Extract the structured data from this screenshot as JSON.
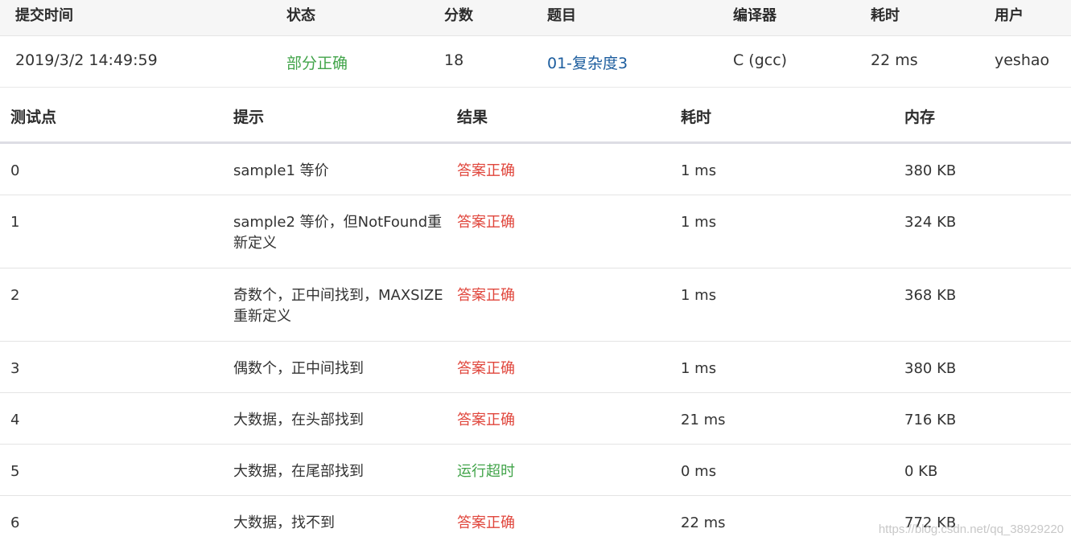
{
  "submission": {
    "headers": [
      "提交时间",
      "状态",
      "分数",
      "题目",
      "编译器",
      "耗时",
      "用户"
    ],
    "row": {
      "time": "2019/3/2 14:49:59",
      "status": "部分正确",
      "score": "18",
      "problem": "01-复杂度3",
      "compiler": "C (gcc)",
      "duration": "22 ms",
      "user": "yeshao"
    }
  },
  "testcases": {
    "headers": [
      "测试点",
      "提示",
      "结果",
      "耗时",
      "内存"
    ],
    "rows": [
      {
        "id": "0",
        "hint": "sample1 等价",
        "result": "答案正确",
        "time": "1 ms",
        "memory": "380 KB"
      },
      {
        "id": "1",
        "hint": "sample2 等价，但NotFound重新定义",
        "result": "答案正确",
        "time": "1 ms",
        "memory": "324 KB"
      },
      {
        "id": "2",
        "hint": "奇数个，正中间找到，MAXSIZE重新定义",
        "result": "答案正确",
        "time": "1 ms",
        "memory": "368 KB"
      },
      {
        "id": "3",
        "hint": "偶数个，正中间找到",
        "result": "答案正确",
        "time": "1 ms",
        "memory": "380 KB"
      },
      {
        "id": "4",
        "hint": "大数据，在头部找到",
        "result": "答案正确",
        "time": "21 ms",
        "memory": "716 KB"
      },
      {
        "id": "5",
        "hint": "大数据，在尾部找到",
        "result": "运行超时",
        "time": "0 ms",
        "memory": "0 KB"
      },
      {
        "id": "6",
        "hint": "大数据，找不到",
        "result": "答案正确",
        "time": "22 ms",
        "memory": "772 KB"
      }
    ]
  },
  "colors": {
    "partial_correct": "#42a44a",
    "accepted": "#e0463c",
    "time_limit_exceeded": "#42a44a",
    "problem_link": "#1c5d9e"
  },
  "watermark": "https://blog.csdn.net/qq_38929220"
}
